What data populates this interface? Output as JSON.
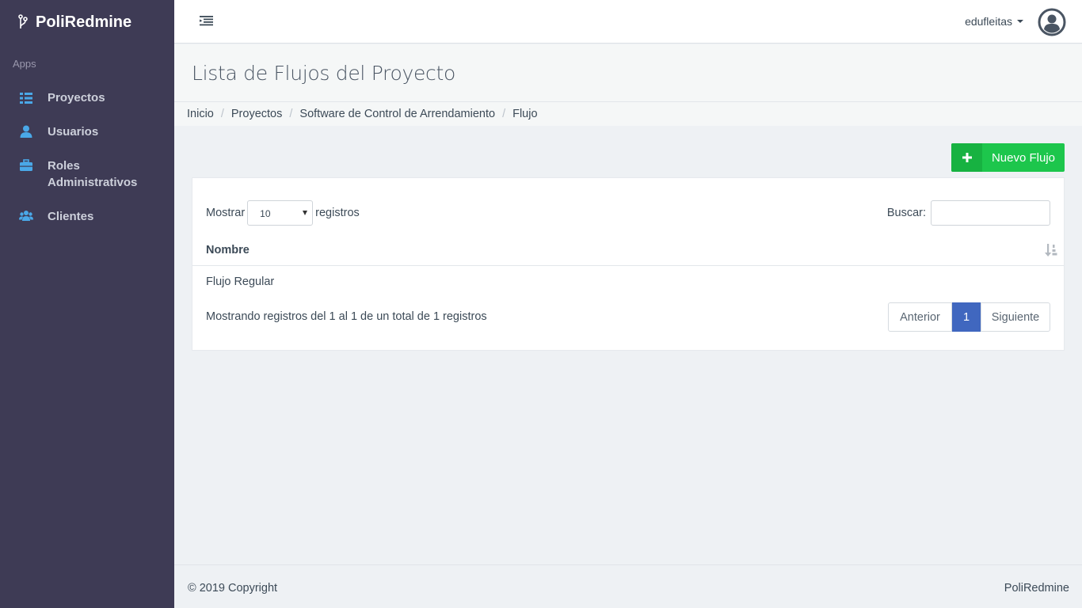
{
  "sidebar": {
    "brand": "PoliRedmine",
    "section_label": "Apps",
    "items": [
      {
        "label": "Proyectos",
        "icon": "table-list-icon"
      },
      {
        "label": "Usuarios",
        "icon": "user-icon"
      },
      {
        "label_line1": "Roles",
        "label_line2": "Administrativos",
        "icon": "briefcase-icon"
      },
      {
        "label": "Clientes",
        "icon": "users-group-icon"
      }
    ],
    "icon_color": "#4aa8e8"
  },
  "topbar": {
    "username": "edufleitas"
  },
  "page": {
    "title": "Lista de Flujos del Proyecto"
  },
  "breadcrumb": [
    "Inicio",
    "Proyectos",
    "Software de Control de Arrendamiento",
    "Flujo"
  ],
  "actions": {
    "new_flow_label": "Nuevo Flujo"
  },
  "table": {
    "show_prefix": "Mostrar",
    "page_length": "10",
    "show_suffix": "registros",
    "search_label": "Buscar:",
    "search_value": "",
    "column_header": "Nombre",
    "rows": [
      "Flujo Regular"
    ],
    "info": "Mostrando registros del 1 al 1 de un total de 1 registros",
    "pagination": {
      "prev": "Anterior",
      "current": "1",
      "next": "Siguiente"
    }
  },
  "footer": {
    "copyright": "© 2019 Copyright",
    "brand": "PoliRedmine"
  },
  "colors": {
    "sidebar_bg": "#3e3b55",
    "accent_green": "#1dc64c",
    "pagination_active": "#4067bf"
  }
}
